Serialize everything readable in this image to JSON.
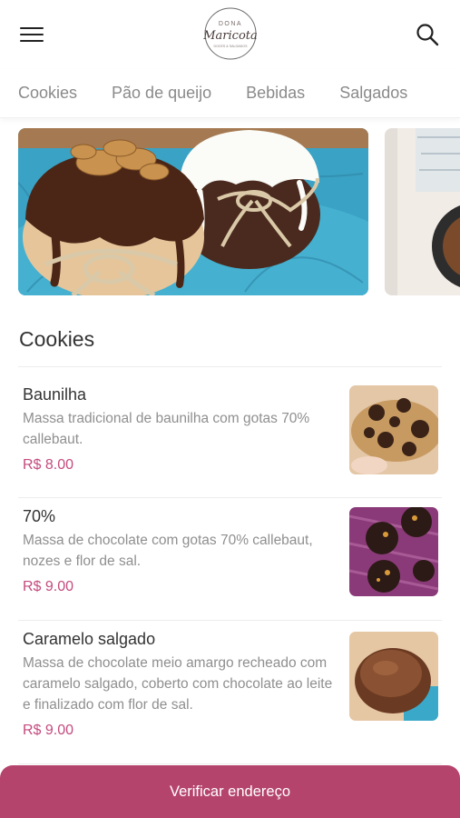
{
  "header": {
    "menu_icon": "hamburger-icon",
    "search_icon": "search-icon",
    "logo": {
      "top": "DONA",
      "name": "Maricota",
      "sub": "DOCES & SALGADOS"
    }
  },
  "tabs": [
    "Cookies",
    "Pão de queijo",
    "Bebidas",
    "Salgados"
  ],
  "section_title": "Cookies",
  "products": [
    {
      "name": "Baunilha",
      "desc": "Massa tradicional de baunilha com gotas 70% callebaut.",
      "price": "R$ 8.00"
    },
    {
      "name": "70%",
      "desc": "Massa de chocolate com gotas 70% callebaut, nozes e flor de sal.",
      "price": "R$ 9.00"
    },
    {
      "name": "Caramelo salgado",
      "desc": "Massa de chocolate meio amargo recheado com caramelo salgado, coberto com chocolate ao leite e finalizado com flor de sal.",
      "price": "R$ 9.00"
    }
  ],
  "cta": {
    "label": "Verificar endereço"
  },
  "colors": {
    "accent": "#b5446d",
    "price": "#c44b7e"
  }
}
